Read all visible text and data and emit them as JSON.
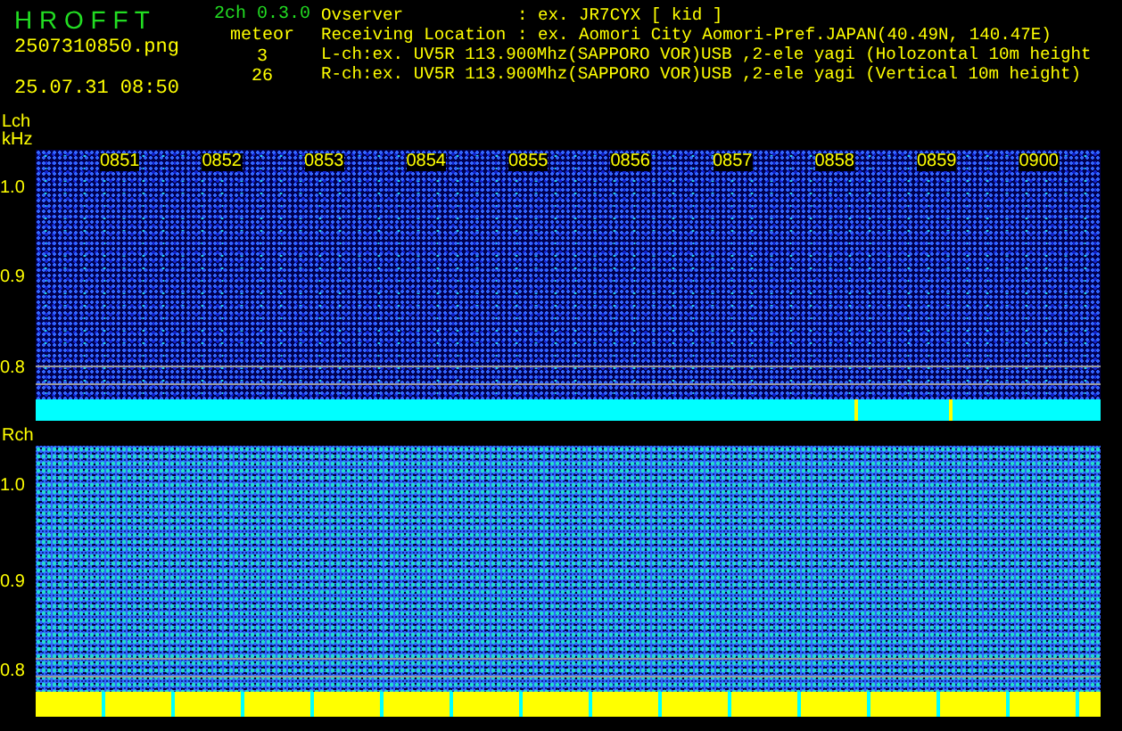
{
  "header": {
    "app_title": "H R O F F T",
    "version": "2ch 0.3.0",
    "filename": "2507310850.png",
    "datetime": "25.07.31 08:50",
    "meteor_label": "meteor",
    "meteor_counts": [
      "3",
      "26"
    ],
    "info": [
      {
        "label": "Ovserver",
        "value": ": ex. JR7CYX [ kid ]"
      },
      {
        "label": "Receiving Location",
        "value": ": ex. Aomori City Aomori-Pref.JAPAN(40.49N, 140.47E)"
      }
    ],
    "channel_lines": [
      "L-ch:ex. UV5R 113.900Mhz(SAPPORO VOR)USB ,2-ele yagi (Holozontal 10m height",
      "R-ch:ex. UV5R 113.900Mhz(SAPPORO VOR)USB ,2-ele yagi (Vertical 10m height)"
    ]
  },
  "channels": [
    {
      "label": "Lch",
      "unit": "kHz",
      "kind": "quiet",
      "y_ticks": [
        "1.0",
        "0.9",
        "0.8"
      ],
      "time_labels": [
        "0851",
        "0852",
        "0853",
        "0854",
        "0855",
        "0856",
        "0857",
        "0858",
        "0859",
        "0900"
      ]
    },
    {
      "label": "Rch",
      "kind": "busy",
      "y_ticks": [
        "1.0",
        "0.9",
        "0.8"
      ]
    }
  ]
}
